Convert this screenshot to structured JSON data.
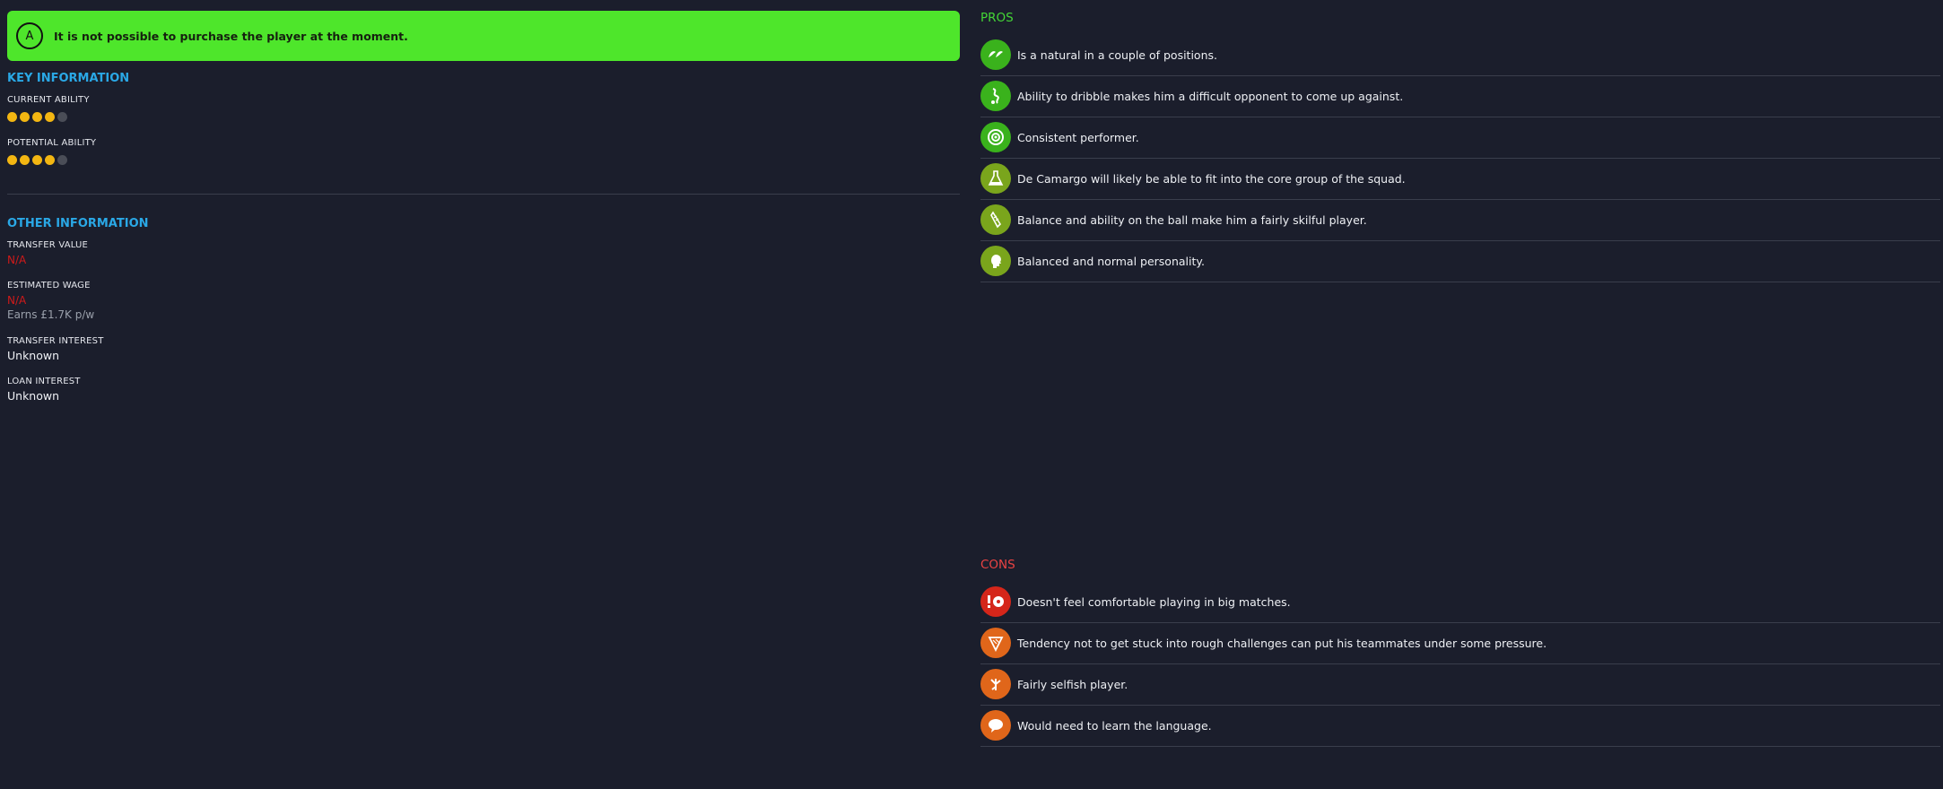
{
  "banner": {
    "badge": "A",
    "message": "It is not possible to purchase the player at the moment."
  },
  "key_information": {
    "title": "KEY INFORMATION",
    "current_ability": {
      "label": "CURRENT ABILITY",
      "stars_filled": 4,
      "stars_total": 5
    },
    "potential_ability": {
      "label": "POTENTIAL ABILITY",
      "stars_filled": 4,
      "stars_total": 5
    }
  },
  "other_information": {
    "title": "OTHER INFORMATION",
    "transfer_value": {
      "label": "TRANSFER VALUE",
      "value": "N/A"
    },
    "estimated_wage": {
      "label": "ESTIMATED WAGE",
      "value": "N/A",
      "note": "Earns £1.7K p/w"
    },
    "transfer_interest": {
      "label": "TRANSFER INTEREST",
      "value": "Unknown"
    },
    "loan_interest": {
      "label": "LOAN INTEREST",
      "value": "Unknown"
    }
  },
  "pros": {
    "title": "PROS",
    "items": [
      {
        "text": "Is a natural in a couple of positions.",
        "icon": "positions-icon",
        "color": "#3ab21c"
      },
      {
        "text": "Ability to dribble makes him a difficult opponent to come up against.",
        "icon": "dribble-icon",
        "color": "#3ab21c"
      },
      {
        "text": "Consistent performer.",
        "icon": "target-icon",
        "color": "#3ab21c"
      },
      {
        "text": "De Camargo will likely be able to fit into the core group of the squad.",
        "icon": "flask-icon",
        "color": "#7aa51c"
      },
      {
        "text": "Balance and ability on the ball make him a fairly skilful player.",
        "icon": "boot-icon",
        "color": "#7aa51c"
      },
      {
        "text": "Balanced and normal personality.",
        "icon": "head-icon",
        "color": "#7aa51c"
      }
    ]
  },
  "cons": {
    "title": "CONS",
    "items": [
      {
        "text": "Doesn't feel comfortable playing in big matches.",
        "icon": "pressure-icon",
        "color": "#d5261a"
      },
      {
        "text": "Tendency not to get stuck into rough challenges can put his teammates under some pressure.",
        "icon": "shield-icon",
        "color": "#e0661a"
      },
      {
        "text": "Fairly selfish player.",
        "icon": "selfish-icon",
        "color": "#e0661a"
      },
      {
        "text": "Would need to learn the language.",
        "icon": "speech-icon",
        "color": "#e0661a"
      }
    ]
  }
}
